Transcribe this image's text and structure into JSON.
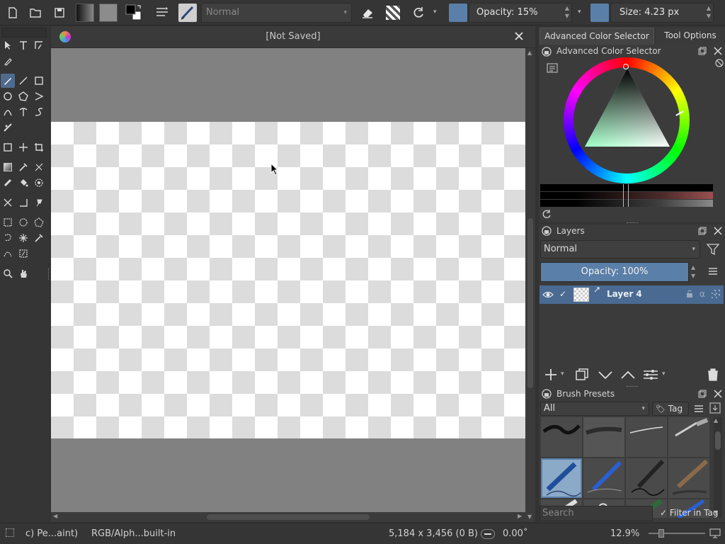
{
  "toolbar": {
    "blend_mode": "Normal",
    "opacity_label": "Opacity: 15%",
    "size_label": "Size: 4.23 px",
    "icons": [
      "new-document-icon",
      "open-document-icon",
      "save-icon",
      "gradient-icon",
      "pattern-icon",
      "fg-bg-color-icon",
      "brush-settings-icon",
      "brush-preset-icon",
      "eraser-icon",
      "alpha-lock-icon",
      "reload-icon"
    ],
    "color": "#5a7fa8"
  },
  "document": {
    "title": "[Not Saved]",
    "canvas_bg": "#818181"
  },
  "docker": {
    "tabs": [
      "Advanced Color Selector",
      "Tool Options"
    ],
    "color_selector_title": "Advanced Color Selector",
    "layers_title": "Layers",
    "layers_blend_mode": "Normal",
    "layers_opacity": "Opacity:  100%",
    "layer_name": "Layer 4",
    "brush_presets_title": "Brush Presets",
    "preset_filter": "All",
    "tag_label": "Tag",
    "search_placeholder": "Search",
    "filter_in_tag": "Filter in Tag"
  },
  "status": {
    "tool_name": "c) Pe...aint)",
    "color_profile": "RGB/Alph...built-in",
    "dimensions": "5,184 x 3,456 (0 B)",
    "rotation": "0.00˚",
    "zoom": "12.9%"
  }
}
